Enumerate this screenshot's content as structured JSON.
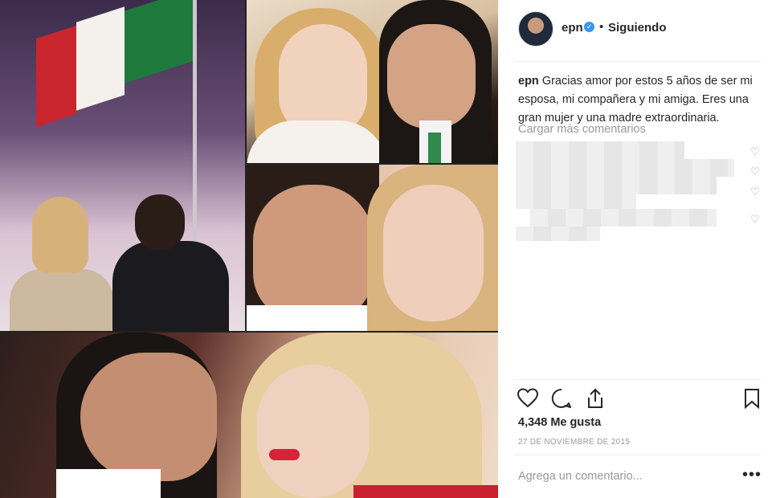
{
  "post": {
    "username": "epn",
    "verified_badge": "✓",
    "separator": "•",
    "follow_status": "Siguiendo",
    "caption_text": "Gracias amor por estos 5 años de ser mi esposa, mi compañera y mi amiga. Eres una gran mujer y una madre extraordinaria.",
    "load_more": "Cargar más comentarios",
    "likes": "4,348 Me gusta",
    "date": "27 DE NOVIEMBRE DE 2015",
    "add_comment_placeholder": "Agrega un comentario...",
    "more_options": "•••"
  },
  "icons": {
    "like": "heart-icon",
    "comment": "comment-icon",
    "share": "share-icon",
    "save": "bookmark-icon",
    "comment_like": "heart-outline-icon"
  },
  "colors": {
    "text": "#262626",
    "muted": "#999999",
    "verified": "#3897f0",
    "divider": "#efefef"
  }
}
